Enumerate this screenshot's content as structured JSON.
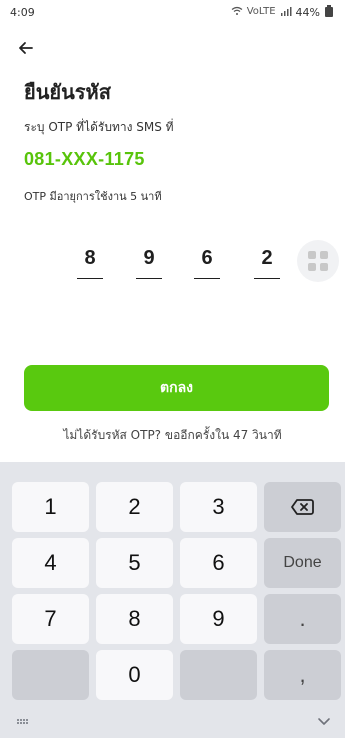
{
  "status_bar": {
    "time": "4:09",
    "network": "VoLTE",
    "battery": "44%"
  },
  "header": {
    "title": "ยืนยันรหัส",
    "subtitle": "ระบุ OTP ที่ได้รับทาง SMS ที่",
    "phone_number": "081-XXX-1175",
    "expiry_note": "OTP มีอายุการใช้งาน 5 นาที"
  },
  "otp": {
    "digits": [
      "8",
      "9",
      "6",
      "2"
    ]
  },
  "actions": {
    "confirm_label": "ตกลง",
    "resend_text": "ไม่ได้รับรหัส OTP? ขออีกครั้งใน 47 วินาที"
  },
  "keyboard": {
    "rows": [
      [
        "1",
        "2",
        "3"
      ],
      [
        "4",
        "5",
        "6",
        "Done"
      ],
      [
        "7",
        "8",
        "9",
        "."
      ],
      [
        "0"
      ]
    ],
    "backspace_icon": "backspace-icon",
    "bottom_left_icon": "keyboard-switch-icon",
    "bottom_right_icon": "chevron-down-icon",
    "comma_key": ","
  },
  "icons": {
    "back": "arrow-left-icon",
    "otp_menu": "grid-icon"
  },
  "colors": {
    "accent": "#58c40b",
    "button": "#59c90f",
    "keyboard_bg": "#e3e5ea",
    "done_text": "#1e73d7"
  }
}
